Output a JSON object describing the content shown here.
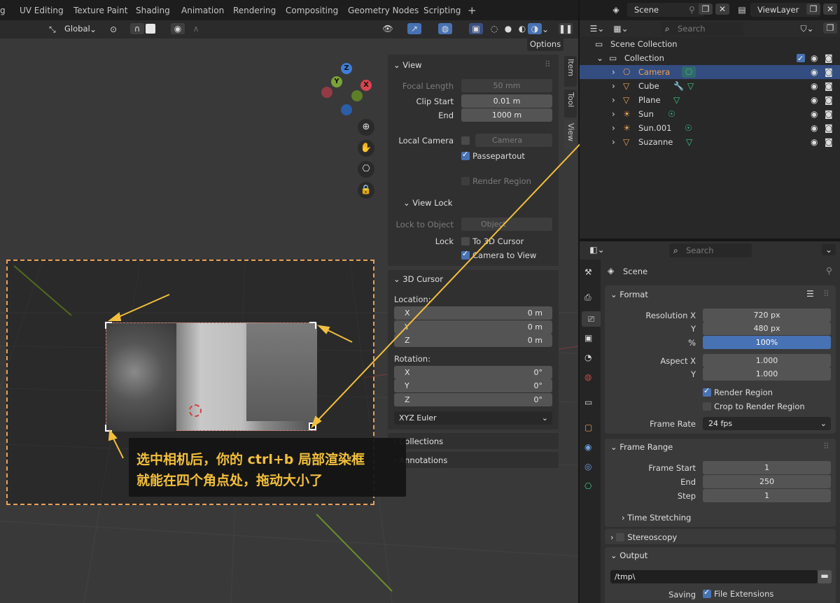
{
  "menubar": {
    "tabs": [
      "g",
      "UV Editing",
      "Texture Paint",
      "Shading",
      "Animation",
      "Rendering",
      "Compositing",
      "Geometry Nodes",
      "Scripting",
      "+"
    ]
  },
  "scene_selector": {
    "value": "Scene"
  },
  "viewlayer_selector": {
    "value": "ViewLayer"
  },
  "viewport_header": {
    "orientation": "Global",
    "options_label": "Options"
  },
  "gizmo": {
    "z": "Z",
    "y": "Y",
    "x": "X"
  },
  "sidebar_tabs": [
    "Item",
    "Tool",
    "View"
  ],
  "view_panel": {
    "title": "View",
    "focal_length_label": "Focal Length",
    "focal_length_value": "50 mm",
    "clip_start_label": "Clip Start",
    "clip_start_value": "0.01 m",
    "end_label": "End",
    "end_value": "1000 m",
    "local_camera_label": "Local Camera",
    "local_camera_value": "Camera",
    "passepartout_label": "Passepartout",
    "render_region_label": "Render Region",
    "view_lock_title": "View Lock",
    "lock_to_object_label": "Lock to Object",
    "lock_to_object_placeholder": "Object",
    "lock_label": "Lock",
    "to_3d_cursor_label": "To 3D Cursor",
    "camera_to_view_label": "Camera to View"
  },
  "cursor_panel": {
    "title": "3D Cursor",
    "location_label": "Location:",
    "location": [
      {
        "axis": "X",
        "value": "0 m"
      },
      {
        "axis": "Y",
        "value": "0 m"
      },
      {
        "axis": "Z",
        "value": "0 m"
      }
    ],
    "rotation_label": "Rotation:",
    "rotation": [
      {
        "axis": "X",
        "value": "0°"
      },
      {
        "axis": "Y",
        "value": "0°"
      },
      {
        "axis": "Z",
        "value": "0°"
      }
    ],
    "rotation_mode": "XYZ Euler"
  },
  "collapsed_panels": {
    "collections": "Collections",
    "annotations": "Annotations"
  },
  "annotation": {
    "line1": "选中相机后，你的 ctrl+b 局部渲染框",
    "line2": "就能在四个角点处，拖动大小了"
  },
  "outliner": {
    "search_placeholder": "Search",
    "scene_collection": "Scene Collection",
    "collection": "Collection",
    "items": [
      {
        "name": "Camera",
        "icon": "camera-icon",
        "data_icon": "camera-data-icon"
      },
      {
        "name": "Cube",
        "icon": "mesh-icon",
        "data_icon": "wrench-icon"
      },
      {
        "name": "Plane",
        "icon": "mesh-icon",
        "data_icon": "mesh-data-icon"
      },
      {
        "name": "Sun",
        "icon": "light-icon",
        "data_icon": "light-data-icon"
      },
      {
        "name": "Sun.001",
        "icon": "light-icon",
        "data_icon": "light-data-icon"
      },
      {
        "name": "Suzanne",
        "icon": "mesh-icon",
        "data_icon": "mesh-data-icon"
      }
    ]
  },
  "properties": {
    "search_placeholder": "Search",
    "scene_label": "Scene",
    "format_title": "Format",
    "resolution_x_label": "Resolution X",
    "resolution_x": "720 px",
    "y_label": "Y",
    "resolution_y": "480 px",
    "percent_label": "%",
    "percent": "100%",
    "aspect_x_label": "Aspect X",
    "aspect_x": "1.000",
    "aspect_y_label": "Y",
    "aspect_y": "1.000",
    "render_region_label": "Render Region",
    "crop_label": "Crop to Render Region",
    "frame_rate_label": "Frame Rate",
    "frame_rate": "24 fps",
    "frame_range_title": "Frame Range",
    "frame_start_label": "Frame Start",
    "frame_start": "1",
    "end_label": "End",
    "frame_end": "250",
    "step_label": "Step",
    "frame_step": "1",
    "time_stretching": "Time Stretching",
    "stereoscopy": "Stereoscopy",
    "output_title": "Output",
    "output_path": "/tmp\\",
    "saving_label": "Saving",
    "file_extensions_label": "File Extensions"
  },
  "colors": {
    "accent": "#4772b3",
    "annotation_yellow": "#f2bf3c",
    "selected_row": "#334d80",
    "camera_orange": "#e8a15a"
  }
}
